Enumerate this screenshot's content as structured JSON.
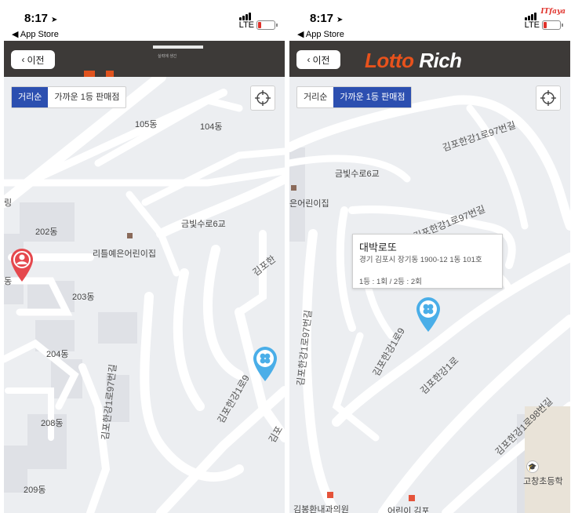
{
  "status": {
    "time": "8:17",
    "location_arrow": "➤",
    "back_to_app": "◀ App Store",
    "network": "LTE"
  },
  "watermark": "ITfaya",
  "header": {
    "back_label": "이전",
    "back_chevron": "‹",
    "logo_word1": "Lotto",
    "logo_word2": "Rich",
    "logo_subtitle": "실력에 생긴"
  },
  "sort_tabs": [
    "거리순",
    "가까운 1등 판매점"
  ],
  "left": {
    "active_tab_index": 0,
    "labels": {
      "b105": "105동",
      "b104": "104동",
      "b202": "202동",
      "b203": "203동",
      "b204": "204동",
      "b208": "208동",
      "b209": "209동",
      "dong_edge": "동",
      "lit_edge": "링",
      "poi_kinder": "리틀예은어린이집",
      "bridge": "금빛수로6교",
      "road_gimpo": "김포한",
      "road_97": "김포한강1로97번길",
      "road_97b": "김포한강1로9",
      "road_gimpo2": "김포"
    }
  },
  "right": {
    "active_tab_index": 1,
    "labels": {
      "road_top": "김포한강1로97번길",
      "bridge": "금빛수로6교",
      "poi_kinder": "은어린이집",
      "road_mid": "김포한강1로97번길",
      "road_left": "김포한강1로97번길",
      "road_pin": "김포한강1로9",
      "road_main": "김포한강1로",
      "road_98": "김포한강1로98번길",
      "school": "고창초등학",
      "poi_bottom1": "김봉환내과의원",
      "poi_bottom2": "어린이 김포"
    },
    "popup": {
      "name": "대박로또",
      "address": "경기 김포시 장기동 1900-12 1동 101호",
      "wins": "1등 : 1회 / 2등 : 2회"
    }
  },
  "icons": {
    "user_location": "person-location-pin-icon",
    "store_pin": "clover-pin-icon",
    "locate": "crosshair-icon"
  },
  "colors": {
    "header_bg": "#3d3a38",
    "logo_orange": "#e8521c",
    "tab_active": "#2c4fb0",
    "user_pin": "#e5484d",
    "store_pin": "#4aaee8",
    "map_bg": "#eceef1"
  }
}
